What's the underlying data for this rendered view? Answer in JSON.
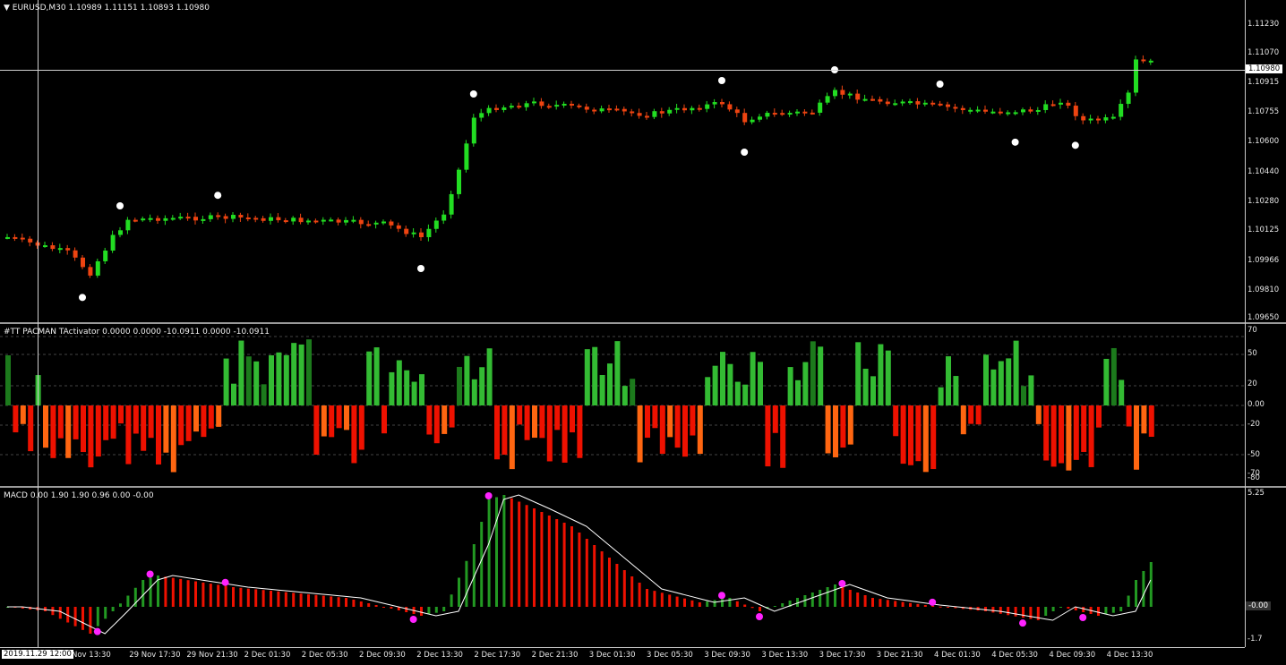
{
  "price": {
    "title": "▼ EURUSD,M30  1.10989 1.11151 1.10893 1.10980",
    "current_label": "1.10980",
    "y_labels": [
      "1.11230",
      "1.11070",
      "1.10915",
      "1.10755",
      "1.10600",
      "1.10440",
      "1.10280",
      "1.10125",
      "1.09966",
      "1.09810",
      "1.09650"
    ],
    "bar_count": 153,
    "signal_dots": [
      {
        "bar": 10,
        "pos": "below"
      },
      {
        "bar": 15,
        "pos": "above"
      },
      {
        "bar": 28,
        "pos": "above"
      },
      {
        "bar": 55,
        "pos": "below"
      },
      {
        "bar": 62,
        "pos": "above"
      },
      {
        "bar": 95,
        "pos": "above"
      },
      {
        "bar": 98,
        "pos": "below"
      },
      {
        "bar": 110,
        "pos": "above"
      },
      {
        "bar": 124,
        "pos": "above"
      },
      {
        "bar": 134,
        "pos": "below"
      },
      {
        "bar": 142,
        "pos": "below"
      }
    ],
    "colors": {
      "up": "#22dd22",
      "down": "#ee4411"
    }
  },
  "pacman": {
    "title": "#TT PACMAN TActivator 0.0000 0.0000 -10.0911 0.0000 -10.0911",
    "y_labels": [
      "70",
      "50",
      "20",
      "0.00",
      "-20",
      "-50",
      "-70",
      "-80"
    ],
    "colors": {
      "pos_light": "#33bb33",
      "pos_dark": "#1c7a1c",
      "neg": "#ee1100",
      "neg_orange": "#ff6611"
    }
  },
  "macd": {
    "title": "MACD 0.00 1.90 1.90 0.96 0.00 -0.00",
    "y_labels": [
      "5.25",
      "-0.00",
      "-1.7"
    ],
    "colors": {
      "up": "#229922",
      "down": "#ee1100",
      "signal": "#ffffff",
      "dots": "#ff22ff"
    }
  },
  "time_axis": {
    "selected": "2019.11.29 12:00",
    "labels": [
      "Nov 13:30",
      "29 Nov 17:30",
      "29 Nov 21:30",
      "2 Dec 01:30",
      "2 Dec 05:30",
      "2 Dec 09:30",
      "2 Dec 13:30",
      "2 Dec 17:30",
      "2 Dec 21:30",
      "3 Dec 01:30",
      "3 Dec 05:30",
      "3 Dec 09:30",
      "3 Dec 13:30",
      "3 Dec 17:30",
      "3 Dec 21:30",
      "4 Dec 01:30",
      "4 Dec 05:30",
      "4 Dec 09:30",
      "4 Dec 13:30"
    ]
  }
}
